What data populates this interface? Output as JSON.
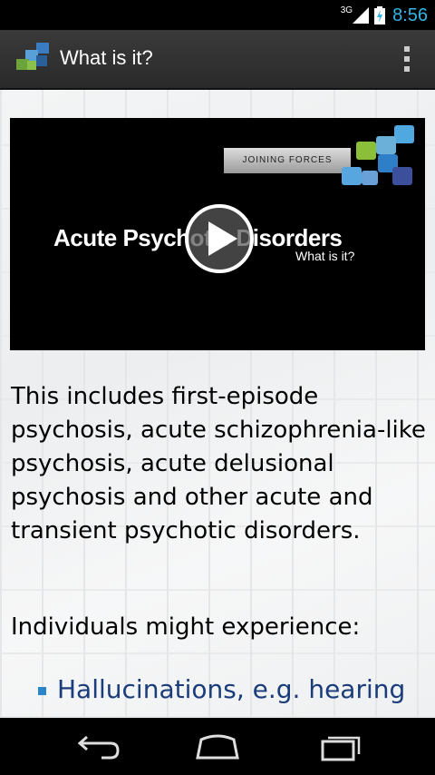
{
  "status_bar": {
    "network": "3G",
    "time": "8:56",
    "time_color": "#33b5e5"
  },
  "action_bar": {
    "title": "What is it?",
    "menu_icon": "overflow-menu-icon"
  },
  "video": {
    "brand": "JOINING FORCES",
    "title": "Acute Psychotic Disorders",
    "subtitle": "What is it?"
  },
  "content": {
    "paragraph1": "This includes first-episode psychosis, acute schizophrenia-like psychosis, acute delusional psychosis and other acute and transient psychotic disorders.",
    "paragraph2": "Individuals might experience:",
    "bullets": [
      {
        "text": "Hallucinations, e.g. hearing"
      }
    ],
    "bullet_color": "#2b86c9",
    "link_color": "#1a3c7a"
  },
  "nav_bar": {
    "back_icon": "back-icon",
    "home_icon": "home-icon",
    "recents_icon": "recents-icon"
  }
}
